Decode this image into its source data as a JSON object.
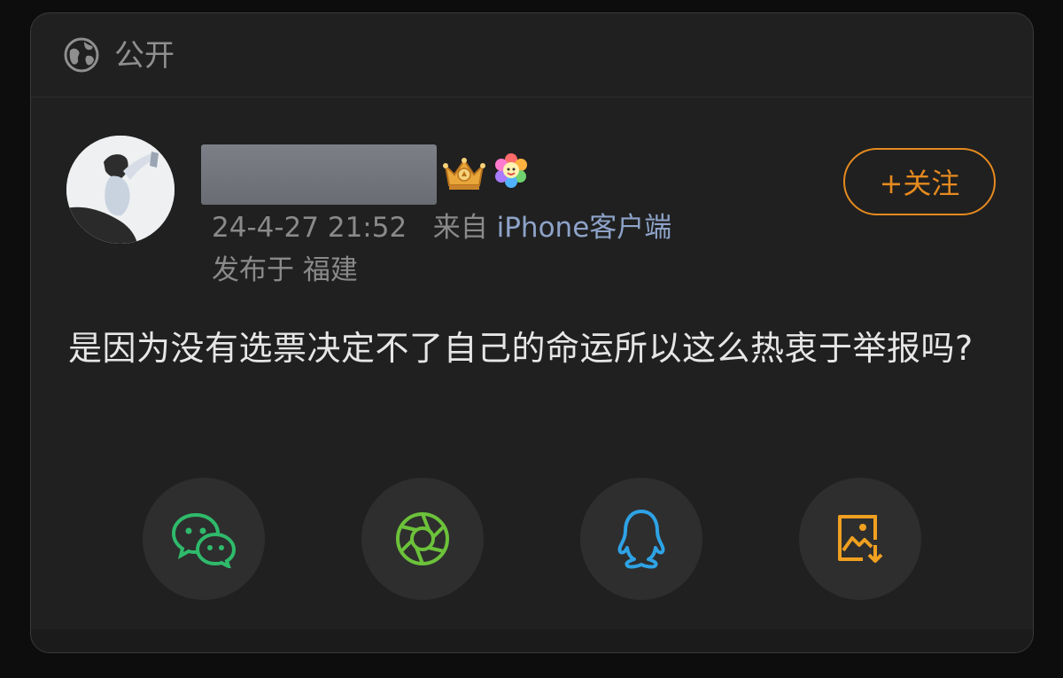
{
  "header": {
    "visibility_label": "公开",
    "globe_icon": "globe-icon"
  },
  "post": {
    "timestamp": "24-4-27 21:52",
    "source_prefix": "来自",
    "source_app": "iPhone客户端",
    "location": "发布于 福建",
    "follow_label": "+关注",
    "body": "是因为没有选票决定不了自己的命运所以这么热衷于举报吗?"
  },
  "share": [
    {
      "name": "wechat-share-button",
      "icon": "wechat-icon",
      "color": "#2fba6b"
    },
    {
      "name": "moments-share-button",
      "icon": "moments-aperture-icon",
      "color": "#6cc23a"
    },
    {
      "name": "qq-share-button",
      "icon": "qq-penguin-icon",
      "color": "#2ea3e6"
    },
    {
      "name": "save-image-button",
      "icon": "save-image-icon",
      "color": "#f0a020"
    }
  ],
  "colors": {
    "accent": "#e58a1f",
    "link": "#8ea3c9",
    "background": "#202020"
  }
}
